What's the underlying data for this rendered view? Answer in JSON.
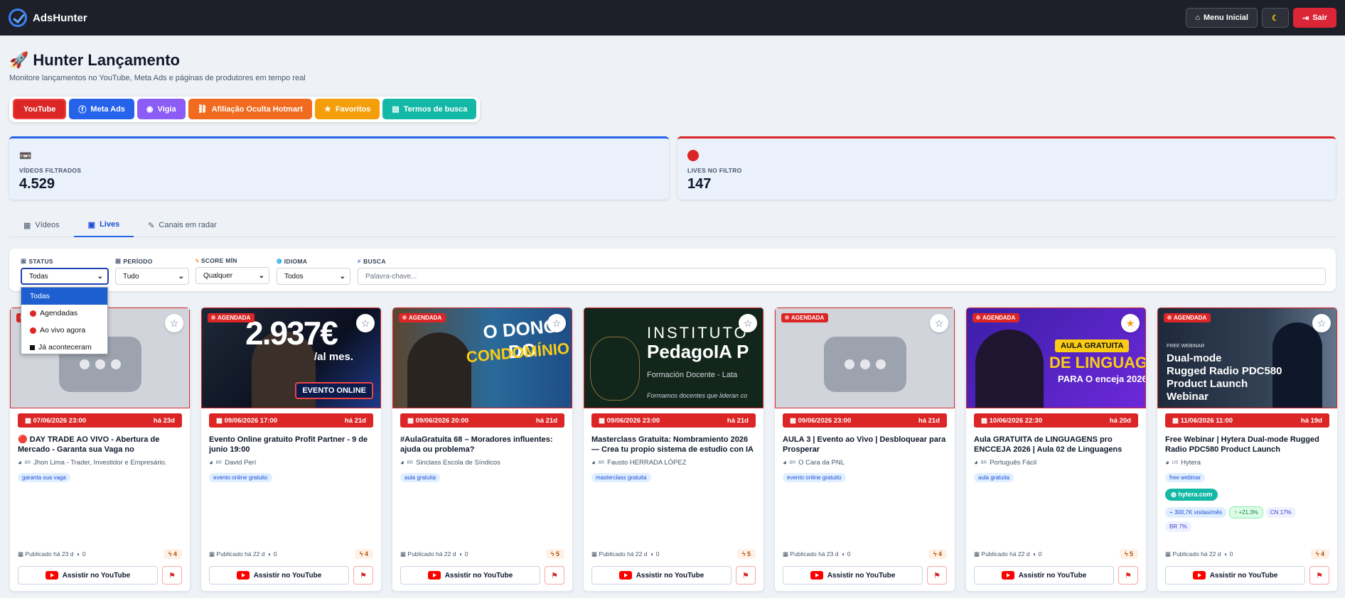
{
  "app": {
    "brand": "AdsHunter"
  },
  "topbar": {
    "menu_label": "Menu Inicial",
    "theme_icon": "moon-icon",
    "logout_label": "Sair"
  },
  "page": {
    "title": "Hunter Lançamento",
    "subtitle": "Monitore lançamentos no YouTube, Meta Ads e páginas de produtores em tempo real"
  },
  "platform_tabs": [
    {
      "label": "YouTube",
      "color": "#dc2626"
    },
    {
      "label": "Meta Ads",
      "color": "#2563eb"
    },
    {
      "label": "Vigia",
      "color": "#8b5cf6"
    },
    {
      "label": "Afiliação Oculta Hotmart",
      "color": "#f06a1f"
    },
    {
      "label": "Favoritos",
      "color": "#f59e0b"
    },
    {
      "label": "Termos de busca",
      "color": "#14b8a6"
    }
  ],
  "stats": [
    {
      "label": "VÍDEOS FILTRADOS",
      "value": "4.529",
      "accent": "#2563eb"
    },
    {
      "label": "LIVES NO FILTRO",
      "value": "147",
      "accent": "#dc2626"
    }
  ],
  "subtabs": [
    "Vídeos",
    "Lives",
    "Canais em radar"
  ],
  "filters": {
    "status": {
      "label": "STATUS",
      "value": "Todas",
      "options": [
        "Todas",
        "Agendadas",
        "Ao vivo agora",
        "Já aconteceram"
      ]
    },
    "periodo": {
      "label": "PERÍODO",
      "value": "Tudo"
    },
    "score": {
      "label": "SCORE MÍN",
      "value": "Qualquer"
    },
    "idioma": {
      "label": "IDIOMA",
      "value": "Todos"
    },
    "busca": {
      "label": "BUSCA",
      "placeholder": "Palavra-chave..."
    }
  },
  "card_common": {
    "badge": "AGENDADA",
    "watch_label": "Assistir no YouTube"
  },
  "cards": [
    {
      "thumb_text": [],
      "date": "07/06/2026 23:00",
      "rel": "há 23d",
      "title": "🔴 DAY TRADE AO VIVO - Abertura de Mercado - Garanta sua Vaga no Treinamento",
      "country": "BR",
      "channel": "Jhon Lima - Trader, Investidor e Empresário.",
      "tag": "garanta sua vaga",
      "published": "Publicado há 23 d",
      "views": "0",
      "score": "4"
    },
    {
      "thumb_text": [
        "2.937€",
        "/al mes.",
        "EVENTO ONLINE"
      ],
      "date": "09/06/2026 17:00",
      "rel": "há 21d",
      "title": "Evento Online gratuito Profit Partner - 9 de junio 19:00",
      "country": "BR",
      "channel": "David Perí",
      "tag": "evento online gratuito",
      "published": "Publicado há 22 d",
      "views": "0",
      "score": "4"
    },
    {
      "thumb_text": [
        "O DONO DO",
        "CONDOMÍNIO"
      ],
      "date": "09/06/2026 20:00",
      "rel": "há 21d",
      "title": "#AulaGratuita 68 – Moradores influentes: ajuda ou problema?",
      "country": "BR",
      "channel": "Sinclass Escola de Síndicos",
      "tag": "aula gratuita",
      "published": "Publicado há 22 d",
      "views": "0",
      "score": "5"
    },
    {
      "thumb_text": [
        "INSTITUTO",
        "PedagoIA P",
        "Formación Docente - Lata",
        "Formamos docentes que lideran co"
      ],
      "date": "09/06/2026 23:00",
      "rel": "há 21d",
      "title": "Masterclass Gratuita: Nombramiento 2026 — Crea tu propio sistema de estudio con IA",
      "country": "BR",
      "channel": "Fausto HERRADA LÓPEZ",
      "tag": "masterclass gratuita",
      "published": "Publicado há 22 d",
      "views": "0",
      "score": "5"
    },
    {
      "thumb_text": [],
      "date": "09/06/2026 23:00",
      "rel": "há 21d",
      "title": "AULA 3 | Evento ao Vivo | Desbloquear para Prosperar",
      "country": "BR",
      "channel": "O Cara da PNL",
      "tag": "evento online gratuito",
      "published": "Publicado há 23 d",
      "views": "0",
      "score": "4"
    },
    {
      "thumb_text": [
        "AULA GRATUITA",
        "DE LINGUAGENS",
        "PARA O enceja 2026"
      ],
      "date": "10/06/2026 22:30",
      "rel": "há 20d",
      "title": "Aula GRATUITA de LINGUAGENS pro ENCCEJA 2026 | Aula 02 de Linguagens",
      "country": "BR",
      "channel": "Português Fácil",
      "tag": "aula gratuita",
      "published": "Publicado há 22 d",
      "views": "0",
      "score": "5"
    },
    {
      "thumb_text": [
        "FREE WEBINAR",
        "Dual-mode",
        "Rugged Radio PDC580",
        "Product Launch Webinar"
      ],
      "date": "11/06/2026 11:00",
      "rel": "há 19d",
      "title": "Free Webinar | Hytera Dual-mode Rugged Radio PDC580 Product Launch",
      "country": "US",
      "channel": "Hytera",
      "tag": "free webinar",
      "domain": "hytera.com",
      "visits": "300,7K visitas/mês",
      "growth": "+21.3%",
      "geo1": "CN 17%",
      "geo2": "BR 7%",
      "published": "Publicado há 22 d",
      "views": "0",
      "score": "4"
    }
  ]
}
